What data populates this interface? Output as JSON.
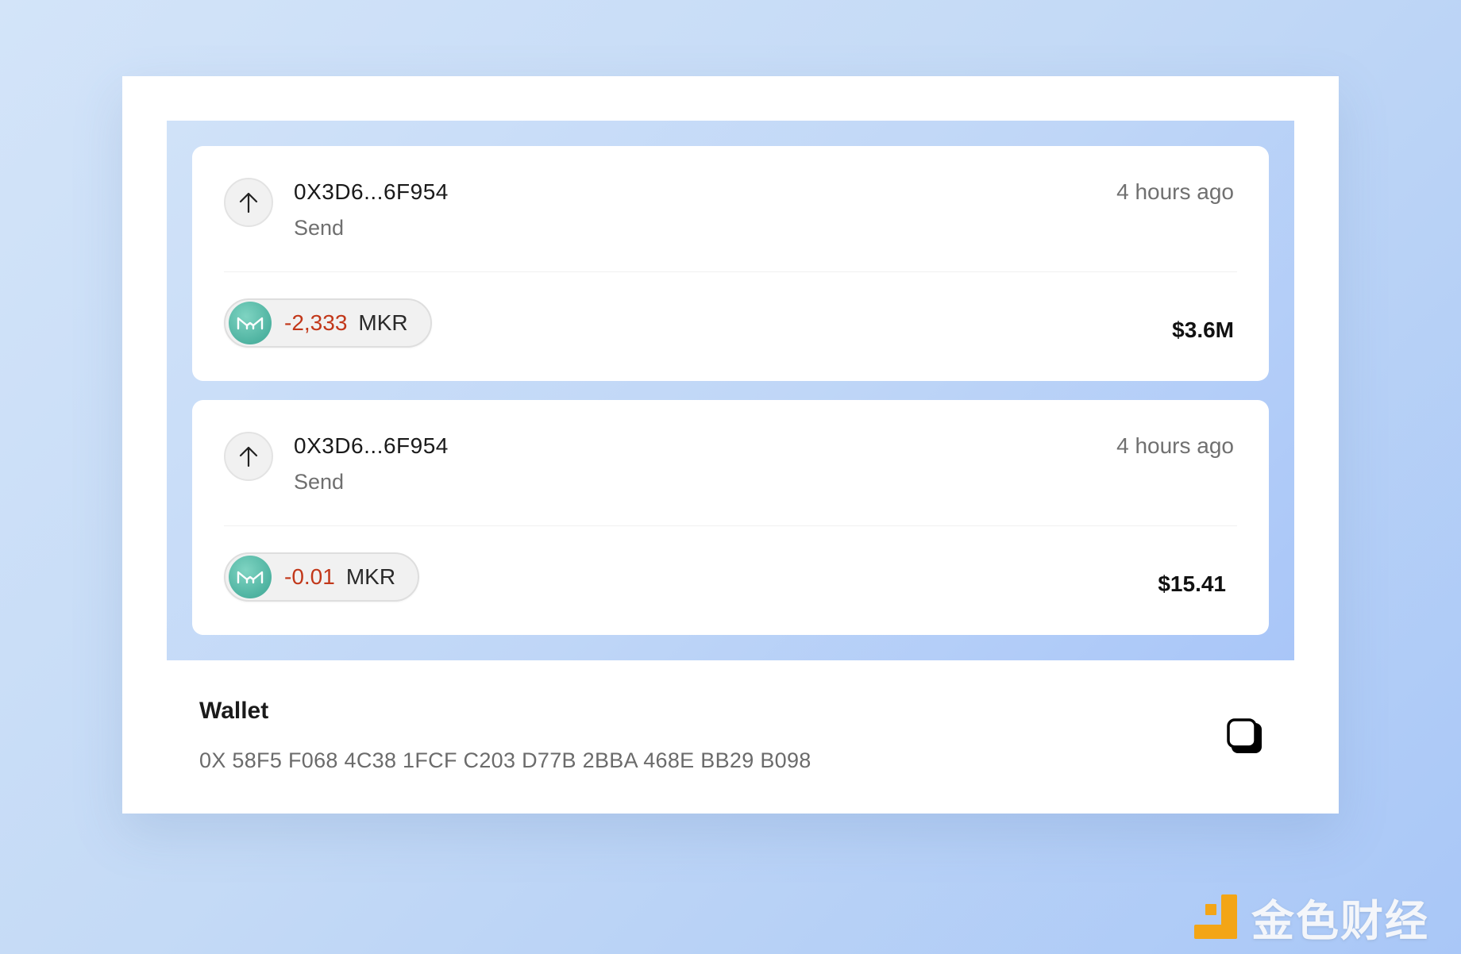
{
  "colors": {
    "negative_amount": "#c2381a",
    "token_logo": "#4fb3a1",
    "watermark_accent": "#f3a516"
  },
  "transactions": [
    {
      "direction_icon": "arrow-up-icon",
      "address": "0X3D6...6F954",
      "type": "Send",
      "time": "4 hours ago",
      "token": {
        "icon": "maker-logo",
        "amount": "-2,333",
        "symbol": "MKR"
      },
      "usd_value": "$3.6M"
    },
    {
      "direction_icon": "arrow-up-icon",
      "address": "0X3D6...6F954",
      "type": "Send",
      "time": "4 hours ago",
      "token": {
        "icon": "maker-logo",
        "amount": "-0.01",
        "symbol": "MKR"
      },
      "usd_value": "$15.41"
    }
  ],
  "wallet": {
    "label": "Wallet",
    "address": "0X 58F5 F068 4C38 1FCF C203 D77B 2BBA 468E BB29 B098",
    "copy_icon": "copy-icon"
  },
  "watermark": {
    "text": "金色财经"
  }
}
